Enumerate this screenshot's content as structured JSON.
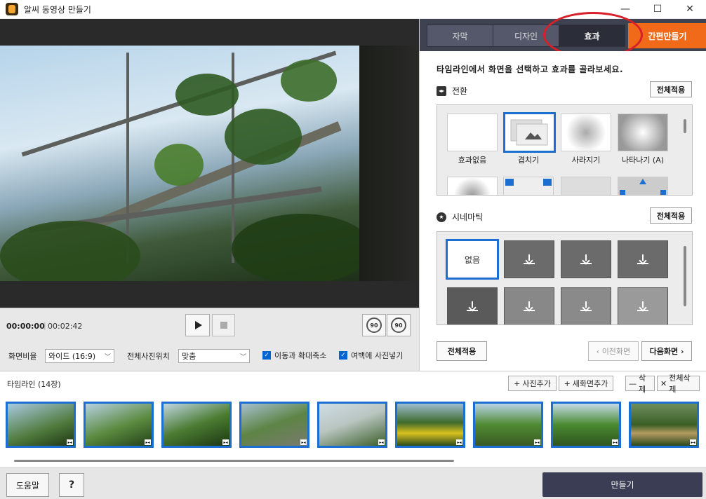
{
  "window": {
    "title": "알씨 동영상 만들기",
    "minimize": "—",
    "maximize": "☐",
    "close": "✕"
  },
  "player": {
    "current_time": "00:00:00",
    "separator": "|",
    "total_time": "00:02:42",
    "rotate_left_label": "90",
    "rotate_right_label": "90"
  },
  "options": {
    "aspect_label": "화면비율",
    "aspect_value": "와이드 (16:9)",
    "position_label": "전체사진위치",
    "position_value": "맞춤",
    "move_zoom_label": "이동과 확대축소",
    "fill_margin_label": "여백에 사진넣기"
  },
  "tabs": [
    {
      "label": "자막"
    },
    {
      "label": "디자인"
    },
    {
      "label": "효과"
    },
    {
      "label": "간편만들기"
    }
  ],
  "effects": {
    "instruction": "타임라인에서 화면을 선택하고 효과를 골라보세요.",
    "transition_title": "전환",
    "apply_all": "전체적용",
    "transitions": [
      {
        "label": "효과없음"
      },
      {
        "label": "겹치기"
      },
      {
        "label": "사라지기"
      },
      {
        "label": "나타나기 (A)"
      }
    ],
    "cinematic_title": "시네마틱",
    "cinematic_none": "없음",
    "cinematic_apply_all": "전체적용",
    "apply_all_bottom": "전체적용",
    "prev_screen": "‹ 이전화면",
    "next_screen": "다음화면 ›"
  },
  "timeline": {
    "title": "타임라인 (14장)",
    "add_photo": "사진추가",
    "add_new_screen": "새화면추가",
    "delete": "삭제",
    "delete_all": "전체삭제",
    "add_icon": "+",
    "minus_icon": "—",
    "x_icon": "✕"
  },
  "footer": {
    "help": "도움말",
    "question": "?",
    "make": "만들기"
  },
  "colors": {
    "accent_blue": "#1a6fd0",
    "orange": "#f06a1a",
    "dark_tab": "#3f4250",
    "highlight_red": "#d8202a"
  }
}
